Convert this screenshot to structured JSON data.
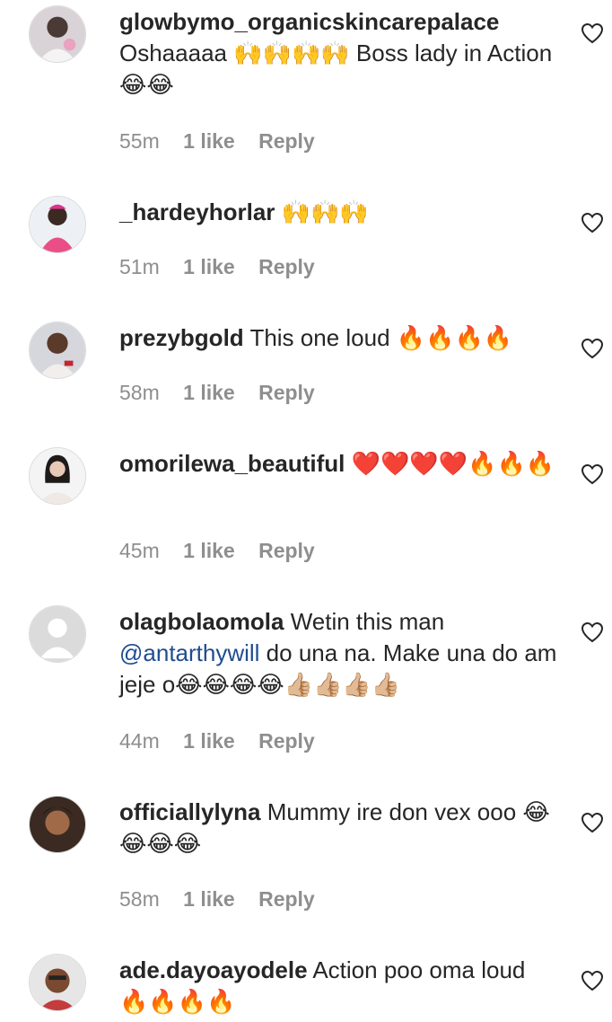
{
  "comments": [
    {
      "username": "glowbymo_organicskincarepalace",
      "text": "Oshaaaaa 🙌🙌🙌🙌 Boss lady in Action 😂😂",
      "time": "55m",
      "likes": "1 like",
      "reply": "Reply",
      "avatar_color": "#c9c1c6"
    },
    {
      "username": "_hardeyhorlar",
      "text": "🙌🙌🙌",
      "time": "51m",
      "likes": "1 like",
      "reply": "Reply",
      "avatar_color": "#e7edf2"
    },
    {
      "username": "prezybgold",
      "text": "This one loud 🔥🔥🔥🔥",
      "time": "58m",
      "likes": "1 like",
      "reply": "Reply",
      "avatar_color": "#d8d8dc"
    },
    {
      "username": "omorilewa_beautiful",
      "text": "❤️❤️❤️❤️🔥🔥🔥",
      "time": "45m",
      "likes": "1 like",
      "reply": "Reply",
      "avatar_color": "#f1f1f1"
    },
    {
      "username": "olagbolaomola",
      "text_before": "Wetin this man ",
      "mention": "@antarthywill",
      "text_after": " do una na. Make una do am jeje o😂😂😂😂👍🏼👍🏼👍🏼👍🏼",
      "time": "44m",
      "likes": "1 like",
      "reply": "Reply",
      "avatar_color": "#dbdbdb"
    },
    {
      "username": "officiallylyna",
      "text": "Mummy ire don vex ooo 😂😂😂😂",
      "time": "58m",
      "likes": "1 like",
      "reply": "Reply",
      "avatar_color": "#6b4a35"
    },
    {
      "username": "ade.dayoayodele",
      "text": "Action poo oma loud 🔥🔥🔥🔥",
      "avatar_color": "#8a5b3e"
    }
  ]
}
